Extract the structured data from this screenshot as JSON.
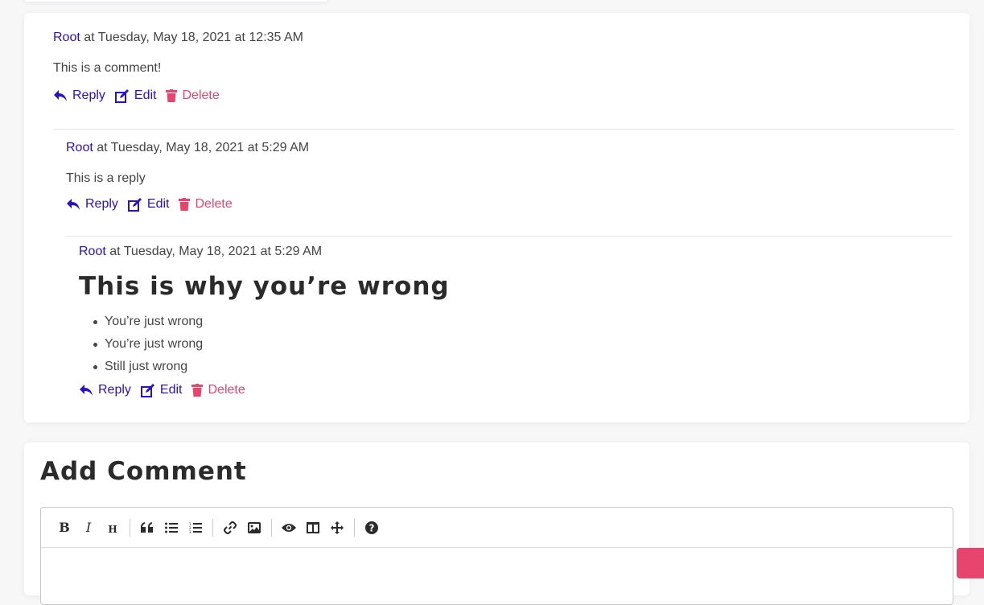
{
  "comments": [
    {
      "author": "Root",
      "meta": " at Tuesday, May 18, 2021 at 12:35 AM",
      "text": "This is a comment!",
      "actions": {
        "reply": "Reply",
        "edit": "Edit",
        "delete": "Delete"
      }
    },
    {
      "author": "Root",
      "meta": " at Tuesday, May 18, 2021 at 5:29 AM",
      "text": "This is a reply",
      "actions": {
        "reply": "Reply",
        "edit": "Edit",
        "delete": "Delete"
      }
    },
    {
      "author": "Root",
      "meta": " at Tuesday, May 18, 2021 at 5:29 AM",
      "heading": "This is why you’re wrong",
      "list": [
        "You’re just wrong",
        "You’re just wrong",
        "Still just wrong"
      ],
      "actions": {
        "reply": "Reply",
        "edit": "Edit",
        "delete": "Delete"
      }
    }
  ],
  "add_comment": {
    "title": "Add Comment",
    "toolbar": {
      "bold": "B",
      "italic": "I",
      "heading": "H",
      "icons": [
        "bold-icon",
        "italic-icon",
        "heading-icon",
        "quote-icon",
        "unordered-list-icon",
        "ordered-list-icon",
        "link-icon",
        "image-icon",
        "preview-icon",
        "side-by-side-icon",
        "fullscreen-icon",
        "help-icon"
      ]
    }
  },
  "colors": {
    "accent": "#2a10c6",
    "danger": "#e8456e",
    "text": "#444444"
  }
}
